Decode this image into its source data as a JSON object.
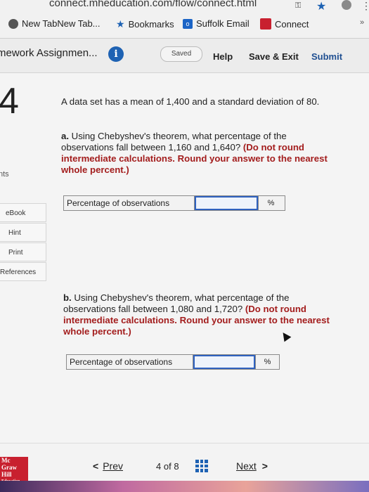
{
  "browser": {
    "url": "connect.mheducation.com/flow/connect.html",
    "bookmarks": [
      {
        "label": "New TabNew Tab...",
        "icon": "globe-icon"
      },
      {
        "label": "Bookmarks",
        "icon": "star-icon"
      },
      {
        "label": "Suffolk Email",
        "icon": "outlook-icon"
      },
      {
        "label": "Connect",
        "icon": "connect-icon"
      }
    ],
    "overflow": "»"
  },
  "header": {
    "assignment_title": "mework Assignmen...",
    "info": "i",
    "saved": "Saved",
    "help": "Help",
    "save_exit": "Save & Exit",
    "submit": "Submit"
  },
  "question": {
    "number": "4",
    "points_fragment": "nts",
    "prompt": "A data set has a mean of 1,400 and a standard deviation of 80.",
    "part_a": {
      "label": "a.",
      "text": "Using Chebyshev's theorem, what percentage of the observations fall between 1,160 and 1,640?",
      "instruction": "(Do not round intermediate calculations. Round your answer to the nearest whole percent.)",
      "answer_label": "Percentage of observations",
      "answer_value": "",
      "unit": "%"
    },
    "part_b": {
      "label": "b.",
      "text": "Using Chebyshev's theorem, what percentage of the observations fall between 1,080 and 1,720?",
      "instruction": "(Do not round intermediate calculations. Round your answer to the nearest whole percent.)",
      "answer_label": "Percentage of observations",
      "answer_value": "",
      "unit": "%"
    }
  },
  "rail": {
    "items": [
      "eBook",
      "Hint",
      "Print",
      "References"
    ]
  },
  "footer": {
    "prev": "Prev",
    "page_current": "4",
    "page_of": "of 8",
    "next": "Next",
    "logo_lines": [
      "Mc",
      "Graw",
      "Hill",
      "Education"
    ]
  },
  "colors": {
    "accent_blue": "#1e62b3",
    "instruction_red": "#a31d1d",
    "input_border": "#2f62c0",
    "logo_red": "#c8202f"
  }
}
